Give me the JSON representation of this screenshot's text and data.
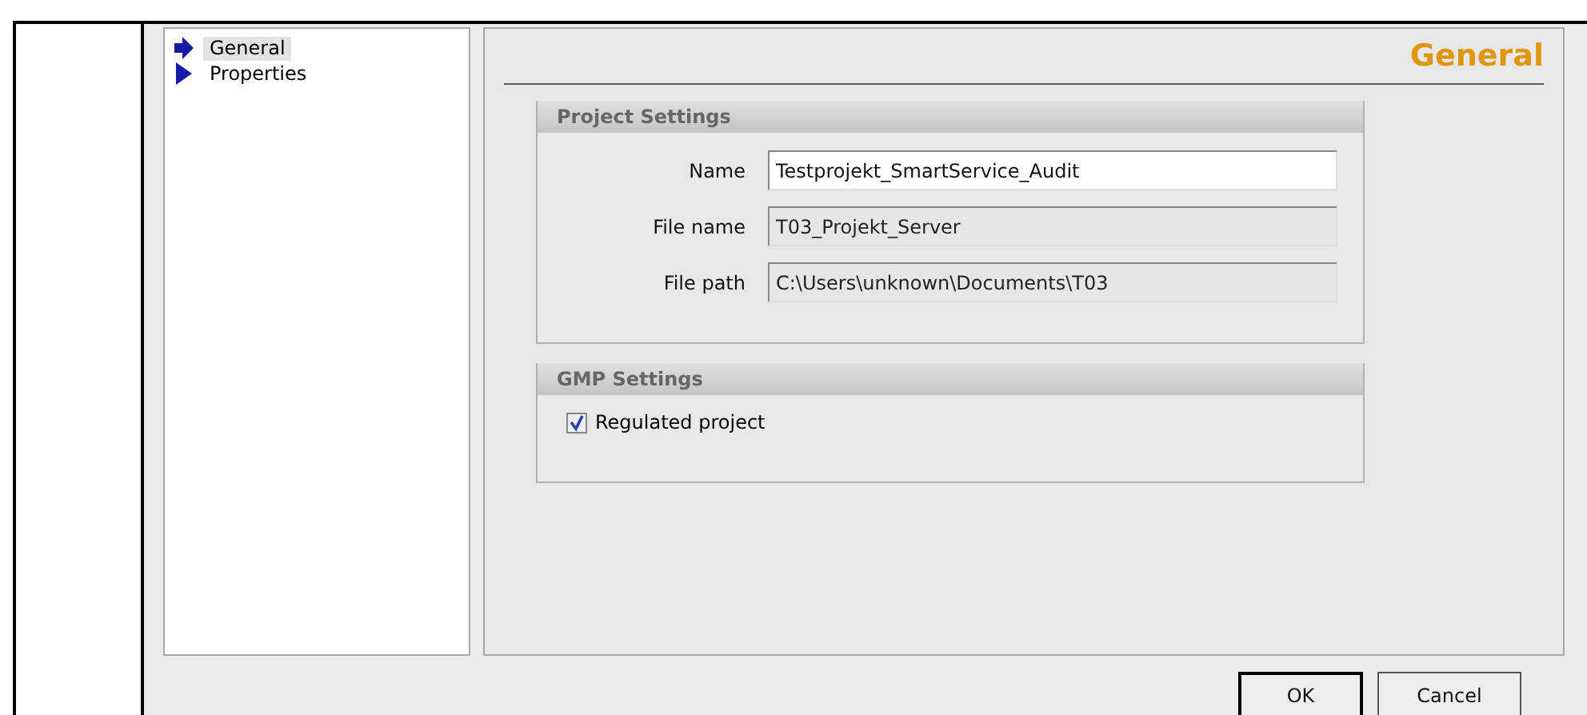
{
  "nav": {
    "items": [
      {
        "label": "General",
        "selected": true
      },
      {
        "label": "Properties",
        "selected": false
      }
    ]
  },
  "page_title": "General",
  "project_settings": {
    "title": "Project Settings",
    "fields": [
      {
        "label": "Name",
        "value": "Testprojekt_SmartService_Audit",
        "disabled": false
      },
      {
        "label": "File name",
        "value": "T03_Projekt_Server",
        "disabled": true
      },
      {
        "label": "File path",
        "value": "C:\\Users\\unknown\\Documents\\T03",
        "disabled": true
      }
    ]
  },
  "gmp_settings": {
    "title": "GMP Settings",
    "checkbox": {
      "label": "Regulated project",
      "checked": true
    }
  },
  "buttons": [
    {
      "label": "OK",
      "default": true
    },
    {
      "label": "Cancel",
      "default": false
    }
  ]
}
